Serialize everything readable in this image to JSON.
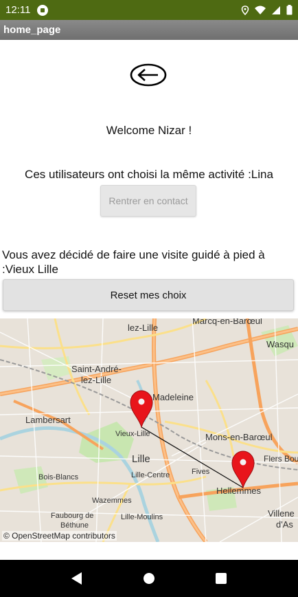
{
  "status_bar": {
    "time": "12:11",
    "icons": [
      "app-notification-icon",
      "location-icon",
      "wifi-icon",
      "signal-icon",
      "battery-icon"
    ]
  },
  "title_bar": {
    "title": "home_page"
  },
  "back_button": {
    "icon": "back-arrow-icon"
  },
  "welcome_text": "Welcome Nizar !",
  "same_activity_text": "Ces utilisateurs ont choisi la même activité :Lina",
  "contact_button_label": "Rentrer en contact",
  "visit_text": "Vous avez décidé de faire une visite guidé à pied à :Vieux Lille",
  "reset_button_label": "Reset mes choix",
  "map": {
    "labels": {
      "marcq": "Marcq-en-Barœul",
      "lez_lille_top": "lez-Lille",
      "wasq": "Wasqu",
      "saint_andre": "Saint-André-",
      "saint_andre_2": "lez-Lille",
      "madeleine": "Madeleine",
      "lambersart": "Lambersart",
      "vieux_lille": "Vieux-Lille",
      "mons": "Mons-en-Barœul",
      "lille": "Lille",
      "flers": "Flers Bou",
      "lille_centre": "Lille-Centre",
      "fives": "Fives",
      "bois_blancs": "Bois-Blancs",
      "hellemmes": "Hellemmes",
      "wazemmes": "Wazemmes",
      "faubourg": "Faubourg de",
      "bethune": "Béthune",
      "lille_moulins": "Lille-Moulins",
      "villene": "Villene",
      "dasc": "d'As"
    },
    "markers": [
      "marker-vieux-lille",
      "marker-hellemmes"
    ],
    "attribution": "© OpenStreetMap contributors",
    "colors": {
      "marker": "#e8151b",
      "route": "#111111",
      "park": "#c8e6b0",
      "water": "#aad3df",
      "highway": "#f7a35c",
      "primary": "#fbe08a"
    }
  },
  "nav_bar": {
    "items": [
      "back-triangle-icon",
      "home-circle-icon",
      "recents-square-icon"
    ]
  }
}
